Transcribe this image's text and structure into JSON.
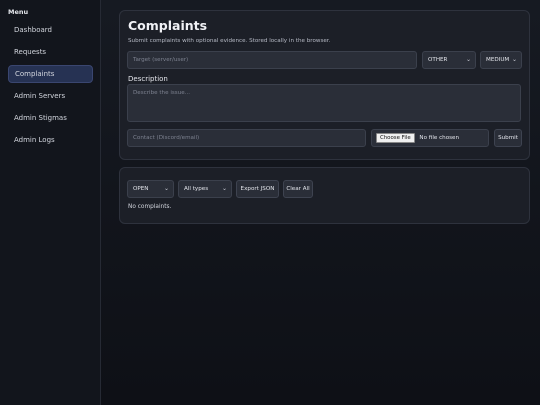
{
  "sidebar": {
    "menu_title": "Menu",
    "items": [
      {
        "label": "Dashboard"
      },
      {
        "label": "Requests"
      },
      {
        "label": "Complaints"
      },
      {
        "label": "Admin Servers"
      },
      {
        "label": "Admin Stigmas"
      },
      {
        "label": "Admin Logs"
      }
    ],
    "active_index": 2
  },
  "form": {
    "title": "Complaints",
    "subtitle": "Submit complaints with optional evidence. Stored locally in the browser.",
    "target_placeholder": "Target (server/user)",
    "type_value": "OTHER",
    "priority_value": "MEDIUM",
    "description_label": "Description",
    "description_placeholder": "Describe the issue...",
    "contact_placeholder": "Contact (Discord/email)",
    "choose_file_label": "Choose File",
    "no_file_text": "No file chosen",
    "submit_label": "Submit"
  },
  "list": {
    "status_filter": "OPEN",
    "type_filter": "All types",
    "export_label": "Export JSON",
    "clear_label": "Clear All",
    "empty_text": "No complaints."
  },
  "colors": {
    "accent": "#263253",
    "card_bg": "#1c1f27",
    "page_bg": "#12151c"
  }
}
